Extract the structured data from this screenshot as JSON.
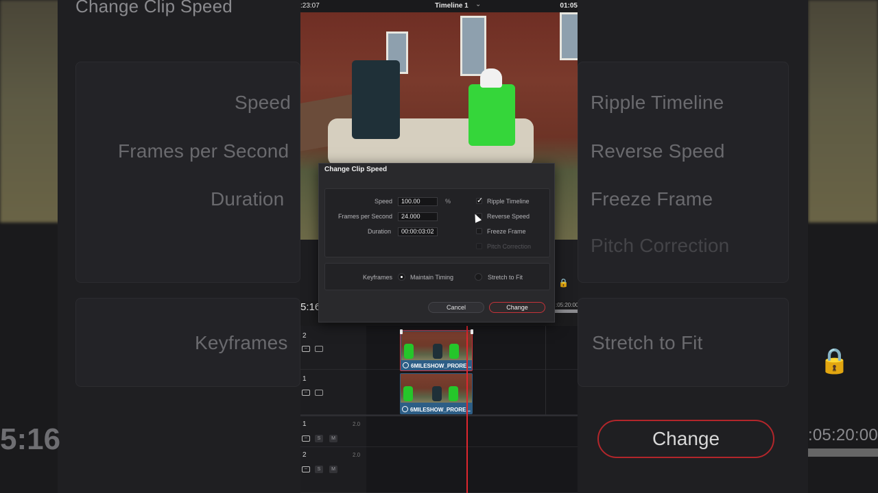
{
  "background": {
    "title_partial": "Change Clip Speed",
    "left_labels": [
      "Speed",
      "Frames per Second",
      "Duration",
      "Keyframes"
    ],
    "right_labels": [
      "Ripple Timeline",
      "Reverse Speed",
      "Freeze Frame",
      "Pitch Correction",
      "Stretch to Fit"
    ],
    "timecode_partial": "5:16",
    "change_label": "Change",
    "ruler_partial": ":05:20:00"
  },
  "viewer": {
    "timecode_left": ":23:07",
    "timeline_name": "Timeline 1",
    "timecode_right": "01:05"
  },
  "timeline": {
    "timecode": "5:16",
    "ruler_mark": ":05:20:00",
    "video_tracks": [
      {
        "number": "2",
        "clip_name": "6MILESHOW_PRORE..."
      },
      {
        "number": "1",
        "clip_name": "6MILESHOW_PRORE..."
      }
    ],
    "audio_tracks": [
      {
        "number": "1",
        "level": "2.0",
        "solo": "S",
        "mute": "M"
      },
      {
        "number": "2",
        "level": "2.0",
        "solo": "S",
        "mute": "M"
      }
    ]
  },
  "dialog": {
    "title": "Change Clip Speed",
    "speed_label": "Speed",
    "speed_value": "100.00",
    "speed_unit": "%",
    "fps_label": "Frames per Second",
    "fps_value": "24.000",
    "duration_label": "Duration",
    "duration_value": "00:00:03:02",
    "options": [
      {
        "label": "Ripple Timeline",
        "checked": true,
        "disabled": false
      },
      {
        "label": "Reverse Speed",
        "checked": false,
        "disabled": false
      },
      {
        "label": "Freeze Frame",
        "checked": false,
        "disabled": false
      },
      {
        "label": "Pitch Correction",
        "checked": false,
        "disabled": true
      }
    ],
    "keyframes_label": "Keyframes",
    "keyframe_modes": [
      {
        "label": "Maintain Timing",
        "selected": true
      },
      {
        "label": "Stretch to Fit",
        "selected": false
      }
    ],
    "cancel_label": "Cancel",
    "change_label": "Change"
  },
  "colors": {
    "accent_red": "#c7333a",
    "clip_blue": "#2d5e86",
    "playhead": "#e0262e"
  }
}
